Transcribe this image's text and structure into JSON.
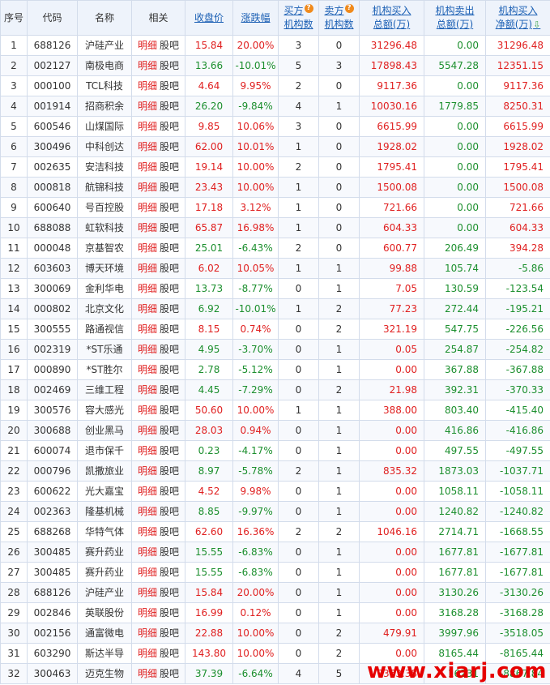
{
  "columns": {
    "idx": "序号",
    "code": "代码",
    "name": "名称",
    "related": "相关",
    "close": "收盘价",
    "change": "涨跌幅",
    "buyers_1": "买方",
    "buyers_2": "机构数",
    "sellers_1": "卖方",
    "sellers_2": "机构数",
    "buy_1": "机构买入",
    "buy_2": "总额(万)",
    "sell_1": "机构卖出",
    "sell_2": "总额(万)",
    "net_1": "机构买入",
    "net_2": "净额(万)"
  },
  "hint_glyph": "?",
  "sort_glyph": "⇩",
  "related_links": {
    "detail": "明细",
    "forum": "股吧"
  },
  "rows": [
    {
      "idx": "1",
      "code": "688126",
      "name": "沪硅产业",
      "close": "15.84",
      "change": "20.00%",
      "buyers": "3",
      "sellers": "0",
      "buy": "31296.48",
      "sell": "0.00",
      "net": "31296.48"
    },
    {
      "idx": "2",
      "code": "002127",
      "name": "南极电商",
      "close": "13.66",
      "change": "-10.01%",
      "buyers": "5",
      "sellers": "3",
      "buy": "17898.43",
      "sell": "5547.28",
      "net": "12351.15"
    },
    {
      "idx": "3",
      "code": "000100",
      "name": "TCL科技",
      "close": "4.64",
      "change": "9.95%",
      "buyers": "2",
      "sellers": "0",
      "buy": "9117.36",
      "sell": "0.00",
      "net": "9117.36"
    },
    {
      "idx": "4",
      "code": "001914",
      "name": "招商积余",
      "close": "26.20",
      "change": "-9.84%",
      "buyers": "4",
      "sellers": "1",
      "buy": "10030.16",
      "sell": "1779.85",
      "net": "8250.31"
    },
    {
      "idx": "5",
      "code": "600546",
      "name": "山煤国际",
      "close": "9.85",
      "change": "10.06%",
      "buyers": "3",
      "sellers": "0",
      "buy": "6615.99",
      "sell": "0.00",
      "net": "6615.99"
    },
    {
      "idx": "6",
      "code": "300496",
      "name": "中科创达",
      "close": "62.00",
      "change": "10.01%",
      "buyers": "1",
      "sellers": "0",
      "buy": "1928.02",
      "sell": "0.00",
      "net": "1928.02"
    },
    {
      "idx": "7",
      "code": "002635",
      "name": "安洁科技",
      "close": "19.14",
      "change": "10.00%",
      "buyers": "2",
      "sellers": "0",
      "buy": "1795.41",
      "sell": "0.00",
      "net": "1795.41"
    },
    {
      "idx": "8",
      "code": "000818",
      "name": "航锦科技",
      "close": "23.43",
      "change": "10.00%",
      "buyers": "1",
      "sellers": "0",
      "buy": "1500.08",
      "sell": "0.00",
      "net": "1500.08"
    },
    {
      "idx": "9",
      "code": "600640",
      "name": "号百控股",
      "close": "17.18",
      "change": "3.12%",
      "buyers": "1",
      "sellers": "0",
      "buy": "721.66",
      "sell": "0.00",
      "net": "721.66"
    },
    {
      "idx": "10",
      "code": "688088",
      "name": "虹软科技",
      "close": "65.87",
      "change": "16.98%",
      "buyers": "1",
      "sellers": "0",
      "buy": "604.33",
      "sell": "0.00",
      "net": "604.33"
    },
    {
      "idx": "11",
      "code": "000048",
      "name": "京基智农",
      "close": "25.01",
      "change": "-6.43%",
      "buyers": "2",
      "sellers": "0",
      "buy": "600.77",
      "sell": "206.49",
      "net": "394.28"
    },
    {
      "idx": "12",
      "code": "603603",
      "name": "博天环境",
      "close": "6.02",
      "change": "10.05%",
      "buyers": "1",
      "sellers": "1",
      "buy": "99.88",
      "sell": "105.74",
      "net": "-5.86"
    },
    {
      "idx": "13",
      "code": "300069",
      "name": "金利华电",
      "close": "13.73",
      "change": "-8.77%",
      "buyers": "0",
      "sellers": "1",
      "buy": "7.05",
      "sell": "130.59",
      "net": "-123.54"
    },
    {
      "idx": "14",
      "code": "000802",
      "name": "北京文化",
      "close": "6.92",
      "change": "-10.01%",
      "buyers": "1",
      "sellers": "2",
      "buy": "77.23",
      "sell": "272.44",
      "net": "-195.21"
    },
    {
      "idx": "15",
      "code": "300555",
      "name": "路通视信",
      "close": "8.15",
      "change": "0.74%",
      "buyers": "0",
      "sellers": "2",
      "buy": "321.19",
      "sell": "547.75",
      "net": "-226.56"
    },
    {
      "idx": "16",
      "code": "002319",
      "name": "*ST乐通",
      "close": "4.95",
      "change": "-3.70%",
      "buyers": "0",
      "sellers": "1",
      "buy": "0.05",
      "sell": "254.87",
      "net": "-254.82"
    },
    {
      "idx": "17",
      "code": "000890",
      "name": "*ST胜尔",
      "close": "2.78",
      "change": "-5.12%",
      "buyers": "0",
      "sellers": "1",
      "buy": "0.00",
      "sell": "367.88",
      "net": "-367.88"
    },
    {
      "idx": "18",
      "code": "002469",
      "name": "三维工程",
      "close": "4.45",
      "change": "-7.29%",
      "buyers": "0",
      "sellers": "2",
      "buy": "21.98",
      "sell": "392.31",
      "net": "-370.33"
    },
    {
      "idx": "19",
      "code": "300576",
      "name": "容大感光",
      "close": "50.60",
      "change": "10.00%",
      "buyers": "1",
      "sellers": "1",
      "buy": "388.00",
      "sell": "803.40",
      "net": "-415.40"
    },
    {
      "idx": "20",
      "code": "300688",
      "name": "创业黑马",
      "close": "28.03",
      "change": "0.94%",
      "buyers": "0",
      "sellers": "1",
      "buy": "0.00",
      "sell": "416.86",
      "net": "-416.86"
    },
    {
      "idx": "21",
      "code": "600074",
      "name": "退市保千",
      "close": "0.23",
      "change": "-4.17%",
      "buyers": "0",
      "sellers": "1",
      "buy": "0.00",
      "sell": "497.55",
      "net": "-497.55"
    },
    {
      "idx": "22",
      "code": "000796",
      "name": "凯撒旅业",
      "close": "8.97",
      "change": "-5.78%",
      "buyers": "2",
      "sellers": "1",
      "buy": "835.32",
      "sell": "1873.03",
      "net": "-1037.71"
    },
    {
      "idx": "23",
      "code": "600622",
      "name": "光大嘉宝",
      "close": "4.52",
      "change": "9.98%",
      "buyers": "0",
      "sellers": "1",
      "buy": "0.00",
      "sell": "1058.11",
      "net": "-1058.11"
    },
    {
      "idx": "24",
      "code": "002363",
      "name": "隆基机械",
      "close": "8.85",
      "change": "-9.97%",
      "buyers": "0",
      "sellers": "1",
      "buy": "0.00",
      "sell": "1240.82",
      "net": "-1240.82"
    },
    {
      "idx": "25",
      "code": "688268",
      "name": "华特气体",
      "close": "62.60",
      "change": "16.36%",
      "buyers": "2",
      "sellers": "2",
      "buy": "1046.16",
      "sell": "2714.71",
      "net": "-1668.55"
    },
    {
      "idx": "26",
      "code": "300485",
      "name": "赛升药业",
      "close": "15.55",
      "change": "-6.83%",
      "buyers": "0",
      "sellers": "1",
      "buy": "0.00",
      "sell": "1677.81",
      "net": "-1677.81"
    },
    {
      "idx": "27",
      "code": "300485",
      "name": "赛升药业",
      "close": "15.55",
      "change": "-6.83%",
      "buyers": "0",
      "sellers": "1",
      "buy": "0.00",
      "sell": "1677.81",
      "net": "-1677.81"
    },
    {
      "idx": "28",
      "code": "688126",
      "name": "沪硅产业",
      "close": "15.84",
      "change": "20.00%",
      "buyers": "0",
      "sellers": "1",
      "buy": "0.00",
      "sell": "3130.26",
      "net": "-3130.26"
    },
    {
      "idx": "29",
      "code": "002846",
      "name": "英联股份",
      "close": "16.99",
      "change": "0.12%",
      "buyers": "0",
      "sellers": "1",
      "buy": "0.00",
      "sell": "3168.28",
      "net": "-3168.28"
    },
    {
      "idx": "30",
      "code": "002156",
      "name": "通富微电",
      "close": "22.88",
      "change": "10.00%",
      "buyers": "0",
      "sellers": "2",
      "buy": "479.91",
      "sell": "3997.96",
      "net": "-3518.05"
    },
    {
      "idx": "31",
      "code": "603290",
      "name": "斯达半导",
      "close": "143.80",
      "change": "10.00%",
      "buyers": "0",
      "sellers": "2",
      "buy": "0.00",
      "sell": "8165.44",
      "net": "-8165.44"
    },
    {
      "idx": "32",
      "code": "300463",
      "name": "迈克生物",
      "close": "37.39",
      "change": "-6.64%",
      "buyers": "4",
      "sellers": "5",
      "buy": "7363.38",
      "sell": "16231",
      "net": "-8867.84"
    }
  ],
  "watermark": "www.xiarj.com",
  "colors": {
    "up": "#e02020",
    "down": "#1c8f2e",
    "header_bg": "#eef3fb",
    "border": "#d3dceb",
    "link": "#1a5fb4",
    "hint": "#f08a1c"
  }
}
